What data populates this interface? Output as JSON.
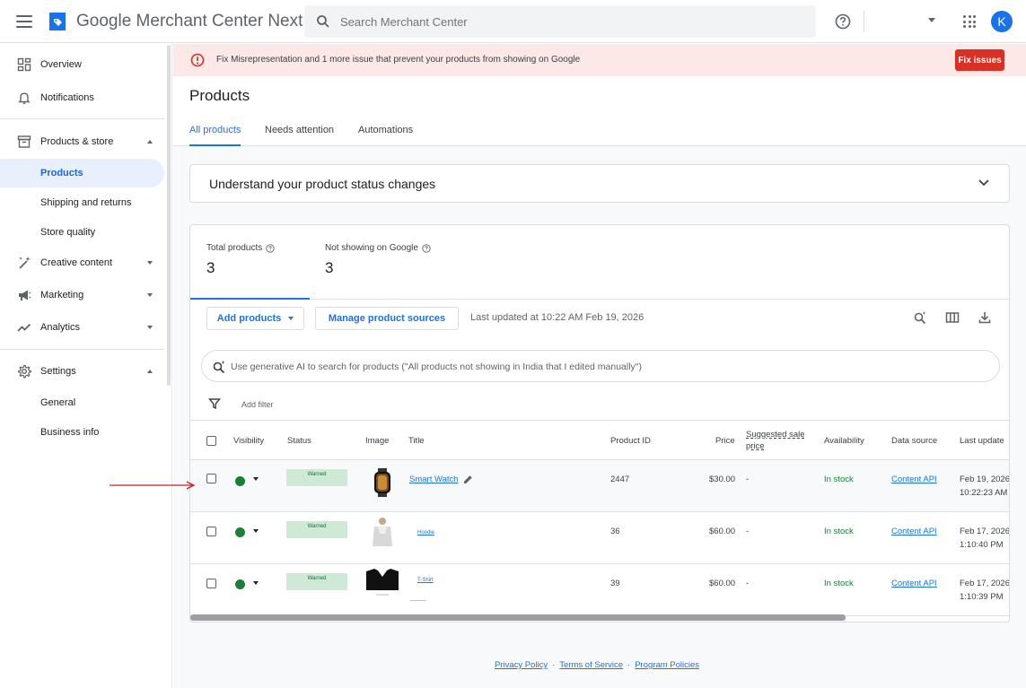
{
  "header": {
    "app_title": "Google Merchant Center Next",
    "search_placeholder": "Search Merchant Center",
    "avatar_letter": "K"
  },
  "sidebar": {
    "items": [
      {
        "label": "Overview",
        "icon": "dashboard-icon"
      },
      {
        "label": "Notifications",
        "icon": "bell-icon"
      },
      {
        "label": "Products & store",
        "icon": "store-icon",
        "expanded": true
      },
      {
        "label": "Products",
        "active": true
      },
      {
        "label": "Shipping and returns"
      },
      {
        "label": "Store quality"
      },
      {
        "label": "Creative content",
        "icon": "magic-wand-icon"
      },
      {
        "label": "Marketing",
        "icon": "megaphone-icon"
      },
      {
        "label": "Analytics",
        "icon": "trending-icon"
      },
      {
        "label": "Settings",
        "icon": "gear-icon",
        "expanded": true
      },
      {
        "label": "General"
      },
      {
        "label": "Business info"
      }
    ]
  },
  "banner": {
    "message": "Fix Misrepresentation and 1 more issue that prevent your products from showing on Google",
    "button": "Fix issues"
  },
  "page": {
    "title": "Products",
    "tabs": [
      "All products",
      "Needs attention",
      "Automations"
    ],
    "accordion_title": "Understand your product status changes"
  },
  "stats": {
    "total_label": "Total products",
    "total_value": "3",
    "not_showing_label": "Not showing on Google",
    "not_showing_value": "3"
  },
  "toolbar": {
    "add_products": "Add products",
    "manage_sources": "Manage product sources",
    "last_updated": "Last updated at 10:22 AM Feb 19, 2026"
  },
  "ai_search": {
    "placeholder": "Use generative AI to search for products (\"All products not showing in India that I edited manually\")"
  },
  "filter": {
    "label": "Add filter"
  },
  "table": {
    "columns": [
      "Visibility",
      "Status",
      "Image",
      "Title",
      "Product ID",
      "Price",
      "Suggested sale price",
      "Availability",
      "Data source",
      "Last update"
    ],
    "rows": [
      {
        "title": "Smart Watch",
        "status": "Warned",
        "product_id": "2447",
        "price": "$30.00",
        "sale_price": "-",
        "availability": "In stock",
        "data_source": "Content API",
        "last_update_date": "Feb 19, 2026",
        "last_update_time": "10:22:23 AM"
      },
      {
        "title": "Hoodie",
        "status": "Warned",
        "product_id": "36",
        "price": "$60.00",
        "sale_price": "-",
        "availability": "In stock",
        "data_source": "Content API",
        "last_update_date": "Feb 17, 2026",
        "last_update_time": "1:10:40 PM"
      },
      {
        "title": "T-Shirt",
        "status": "Warned",
        "product_id": "39",
        "price": "$60.00",
        "sale_price": "-",
        "availability": "In stock",
        "data_source": "Content API",
        "last_update_date": "Feb 17, 2026",
        "last_update_time": "1:10:39 PM"
      }
    ]
  },
  "footer": {
    "links": [
      "Privacy Policy",
      "Terms of Service",
      "Program Policies"
    ],
    "separator": "·"
  },
  "colors": {
    "accent": "#1a73e8",
    "error": "#d93025",
    "success": "#188038",
    "banner_bg": "#fce8e6"
  }
}
